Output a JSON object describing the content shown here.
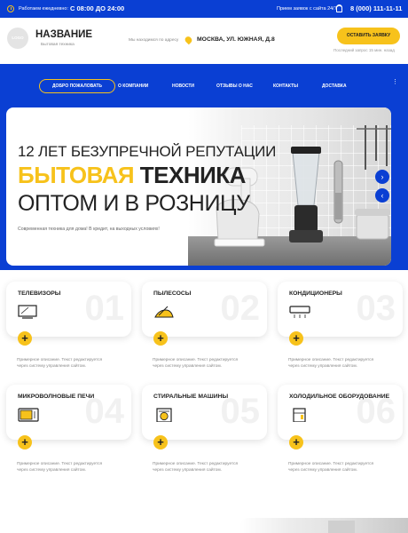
{
  "topbar": {
    "hours_label": "Работаем ежедневно:",
    "hours": "С 08:00 ДО 24:00",
    "accept_label": "Прием заявок с сайта 24/7",
    "phone": "8 (000) 111-11-11"
  },
  "header": {
    "logo_text": "LOGO",
    "brand_name": "НАЗВАНИЕ",
    "brand_sub": "Бытовая техника",
    "location_label": "Мы находимся по адресу",
    "address": "МОСКВА, УЛ. ЮЖНАЯ, Д.8",
    "order_button": "ОСТАВИТЬ ЗАЯВКУ",
    "last_request": "Последний запрос 15 мин. назад"
  },
  "nav": {
    "items": [
      "ДОБРО ПОЖАЛОВАТЬ",
      "О КОМПАНИИ",
      "НОВОСТИ",
      "ОТЗЫВЫ О НАС",
      "КОНТАКТЫ",
      "ДОСТАВКА"
    ],
    "more": "⋮"
  },
  "hero": {
    "line1": "12 ЛЕТ БЕЗУПРЕЧНОЙ РЕПУТАЦИИ",
    "line2_yellow": "БЫТОВАЯ",
    "line2_dark": "ТЕХНИКА",
    "line3": "ОПТОМ И В РОЗНИЦУ",
    "subtitle": "Современная техника для дома! В кредит, на выходных условиях!",
    "next_icon": "›",
    "prev_icon": "‹"
  },
  "categories": [
    {
      "title": "ТЕЛЕВИЗОРЫ",
      "num": "01",
      "icon": "tv-icon",
      "desc1": "Примерное описание. Текст редактируется",
      "desc2": "через систему управления сайтом."
    },
    {
      "title": "ПЫЛЕСОСЫ",
      "num": "02",
      "icon": "vacuum-icon",
      "desc1": "Примерное описание. Текст редактируется",
      "desc2": "через систему управления сайтом."
    },
    {
      "title": "КОНДИЦИОНЕРЫ",
      "num": "03",
      "icon": "air-conditioner-icon",
      "desc1": "Примерное описание. Текст редактируется",
      "desc2": "через систему управления сайтом."
    },
    {
      "title": "МИКРОВОЛНОВЫЕ ПЕЧИ",
      "num": "04",
      "icon": "microwave-icon",
      "desc1": "Примерное описание. Текст редактируется",
      "desc2": "через систему управления сайтом."
    },
    {
      "title": "СТИРАЛЬНЫЕ МАШИНЫ",
      "num": "05",
      "icon": "washing-machine-icon",
      "desc1": "Примерное описание. Текст редактируется",
      "desc2": "через систему управления сайтом."
    },
    {
      "title": "ХОЛОДИЛЬНОЕ ОБОРУДОВАНИЕ",
      "num": "06",
      "icon": "fridge-icon",
      "desc1": "Примерное описание. Текст редактируется",
      "desc2": "через систему управления сайтом."
    }
  ],
  "plus_symbol": "+",
  "colors": {
    "brand_blue": "#0a3fd3",
    "accent_yellow": "#f7c21b"
  }
}
